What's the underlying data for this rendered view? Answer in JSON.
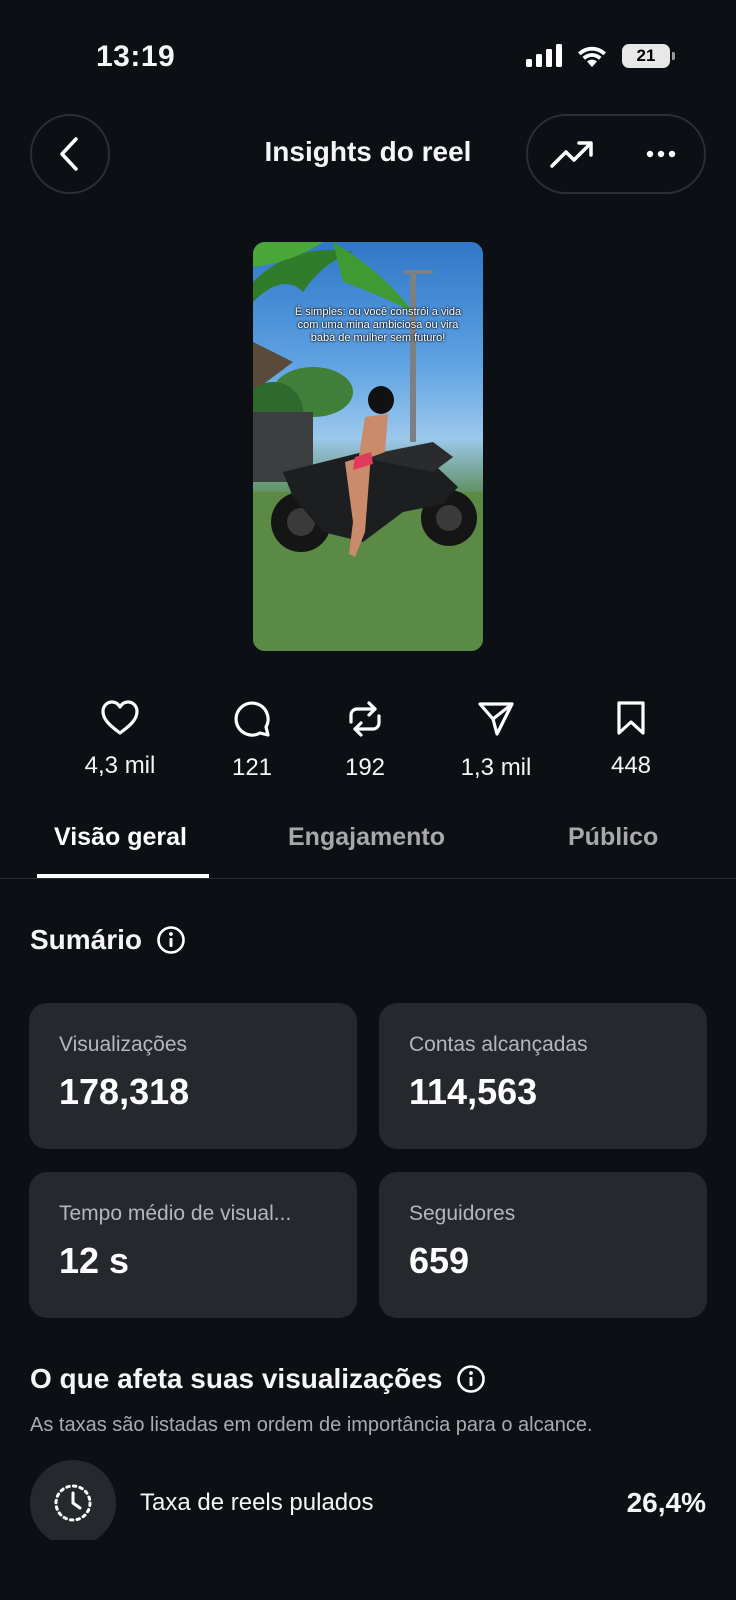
{
  "status_bar": {
    "time": "13:19",
    "battery": "21"
  },
  "header": {
    "title": "Insights do reel"
  },
  "reel": {
    "caption": "É simples: ou você constrói a vida com uma mina ambiciosa ou vira babá de mulher sem futuro!"
  },
  "stats": {
    "likes": "4,3 mil",
    "comments": "121",
    "reposts": "192",
    "shares": "1,3 mil",
    "saves": "448"
  },
  "tabs": [
    {
      "label": "Visão geral",
      "active": true
    },
    {
      "label": "Engajamento",
      "active": false
    },
    {
      "label": "Público",
      "active": false
    }
  ],
  "summary": {
    "title": "Sumário",
    "cards": [
      {
        "label": "Visualizações",
        "value": "178,318"
      },
      {
        "label": "Contas alcançadas",
        "value": "114,563"
      },
      {
        "label": "Tempo médio de visual...",
        "value": "12 s"
      },
      {
        "label": "Seguidores",
        "value": "659"
      }
    ]
  },
  "affects": {
    "title": "O que afeta suas visualizações",
    "subtitle": "As taxas são listadas em ordem de importância para o alcance.",
    "rows": [
      {
        "label": "Taxa de reels pulados",
        "value": "26,4%"
      }
    ]
  }
}
